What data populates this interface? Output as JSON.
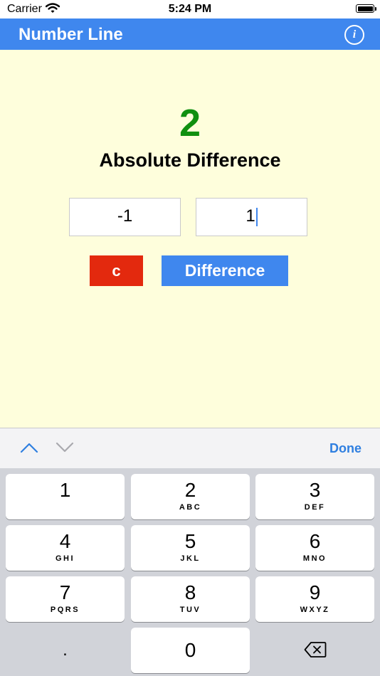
{
  "status_bar": {
    "carrier": "Carrier",
    "time": "5:24 PM"
  },
  "nav": {
    "title": "Number Line",
    "info_label": "i"
  },
  "result": {
    "value": "2",
    "label": "Absolute Difference"
  },
  "inputs": {
    "first": "-1",
    "second": "1"
  },
  "buttons": {
    "clear": "c",
    "difference": "Difference"
  },
  "keyboard_toolbar": {
    "done": "Done"
  },
  "keypad": {
    "keys": [
      {
        "digit": "1",
        "letters": ""
      },
      {
        "digit": "2",
        "letters": "ABC"
      },
      {
        "digit": "3",
        "letters": "DEF"
      },
      {
        "digit": "4",
        "letters": "GHI"
      },
      {
        "digit": "5",
        "letters": "JKL"
      },
      {
        "digit": "6",
        "letters": "MNO"
      },
      {
        "digit": "7",
        "letters": "PQRS"
      },
      {
        "digit": "8",
        "letters": "TUV"
      },
      {
        "digit": "9",
        "letters": "WXYZ"
      }
    ],
    "dot": ".",
    "zero": "0"
  },
  "colors": {
    "nav_bar": "#3f87ee",
    "background": "#fefedc",
    "result_value": "#109010",
    "clear_button": "#e3290e",
    "difference_button": "#3f87ee",
    "done_link": "#2f7fe0"
  }
}
